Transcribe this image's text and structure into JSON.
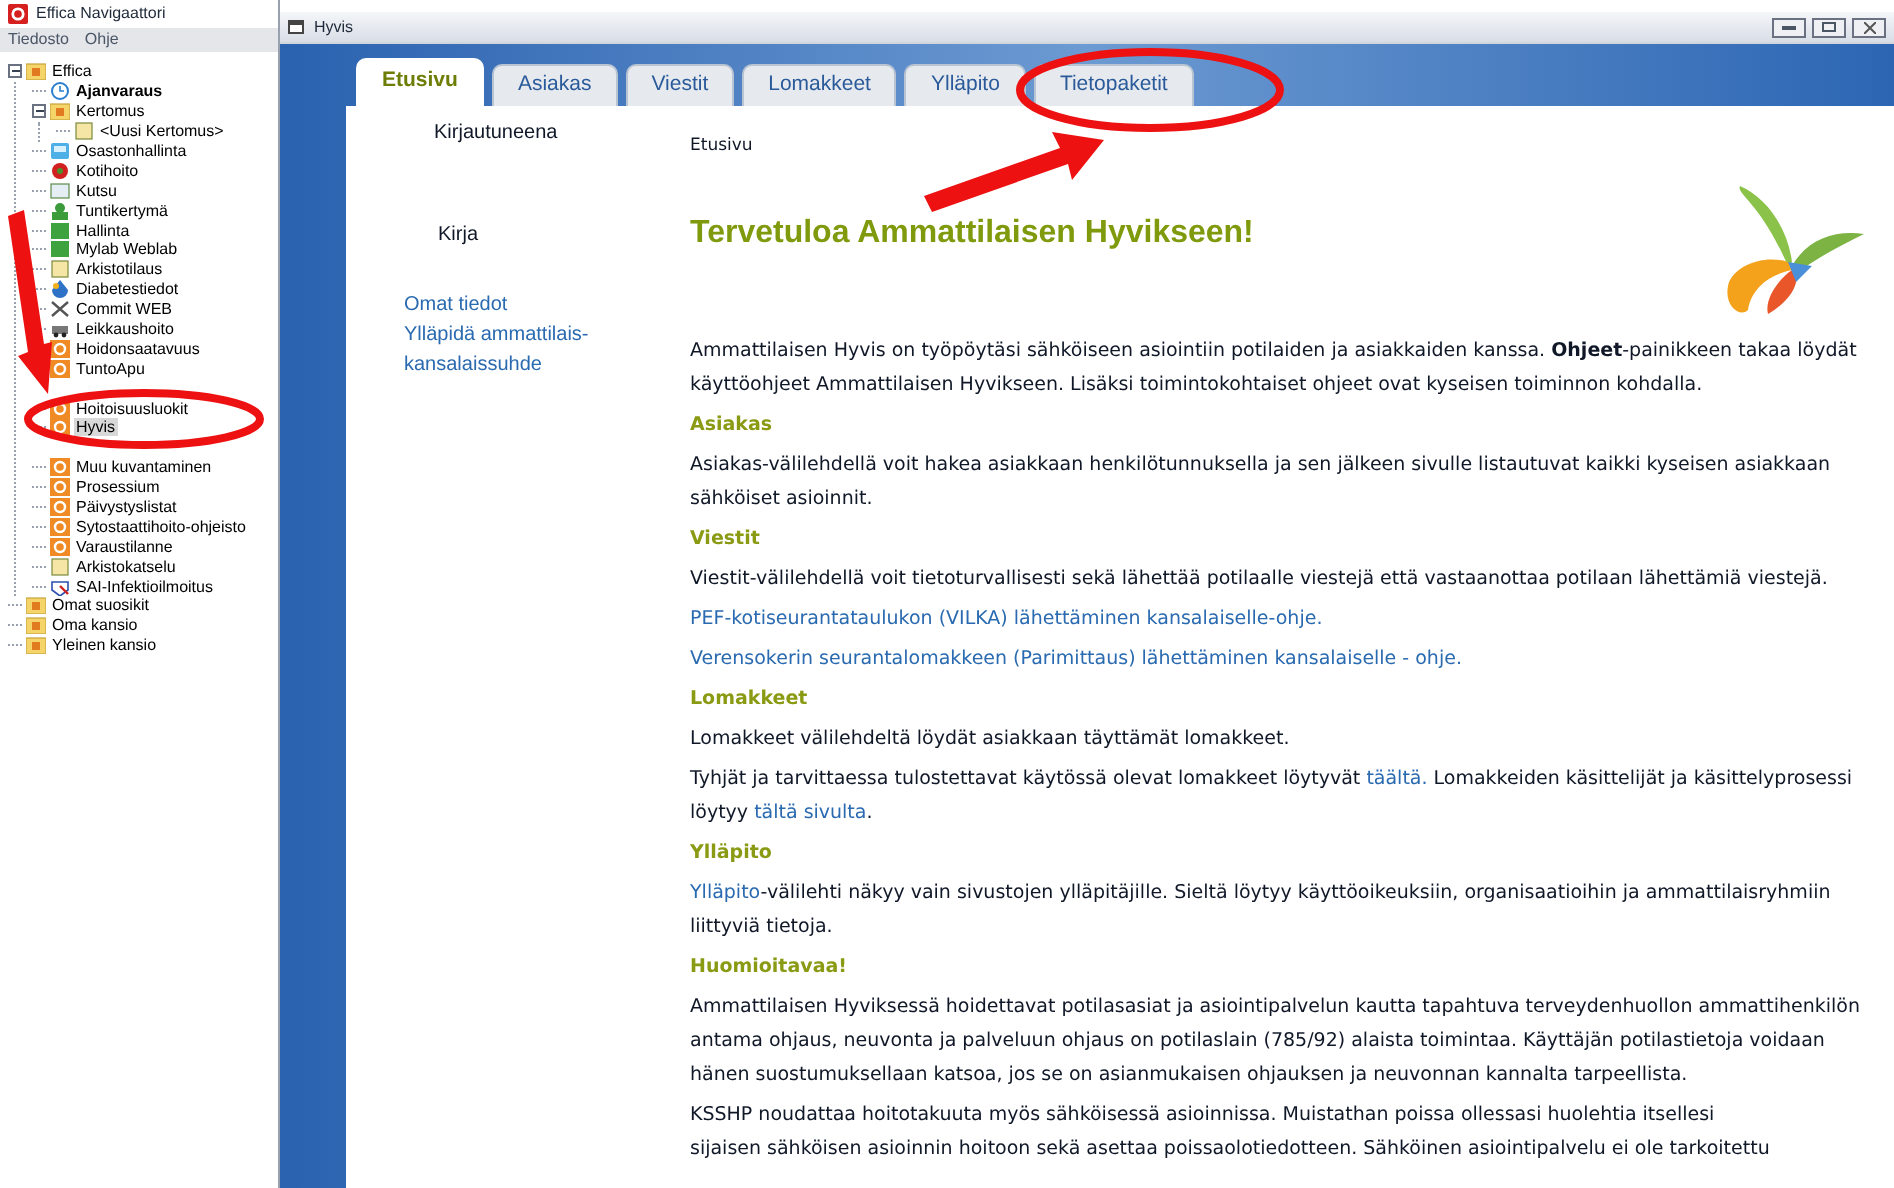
{
  "navigator": {
    "title": "Effica Navigaattori",
    "menu": [
      "Tiedosto",
      "Ohje"
    ],
    "tree": [
      {
        "label": "Effica",
        "expanded": true,
        "selected": false,
        "default": false,
        "children": [
          {
            "label": "Ajanvaraus",
            "selected": false,
            "default": true
          },
          {
            "label": "Kertomus",
            "expanded": true,
            "selected": false,
            "default": false,
            "children": [
              {
                "label": "<Uusi Kertomus>",
                "selected": false,
                "default": false
              }
            ]
          },
          {
            "label": "Osastonhallinta",
            "selected": false,
            "default": false
          },
          {
            "label": "Kotihoito",
            "selected": false,
            "default": false
          },
          {
            "label": "Kutsu",
            "selected": false,
            "default": false
          },
          {
            "label": "Tuntikertymä",
            "selected": false,
            "default": false
          },
          {
            "label": "Hallinta",
            "selected": false,
            "default": false
          },
          {
            "label": "Mylab Weblab",
            "selected": false,
            "default": false
          },
          {
            "label": "Arkistotilaus",
            "selected": false,
            "default": false
          },
          {
            "label": "Diabetestiedot",
            "selected": false,
            "default": false
          },
          {
            "label": "Commit WEB",
            "selected": false,
            "default": false
          },
          {
            "label": "Leikkaushoito",
            "selected": false,
            "default": false
          },
          {
            "label": "Hoidonsaatavuus",
            "selected": false,
            "default": false
          },
          {
            "label": "TuntoApu",
            "selected": false,
            "default": false
          },
          {
            "label": "Hoitoisuusluokit",
            "selected": false,
            "default": false
          },
          {
            "label": "Hyvis",
            "selected": true,
            "default": false
          },
          {
            "label": "Muu kuvantaminen",
            "selected": false,
            "default": false
          },
          {
            "label": "Prosessium",
            "selected": false,
            "default": false
          },
          {
            "label": "Päivystyslistat",
            "selected": false,
            "default": false
          },
          {
            "label": "Sytostaattihoito-ohjeisto",
            "selected": false,
            "default": false
          },
          {
            "label": "Varaustilanne",
            "selected": false,
            "default": false
          },
          {
            "label": "Arkistokatselu",
            "selected": false,
            "default": false
          },
          {
            "label": "SAI-Infektioilmoitus",
            "selected": false,
            "default": false
          }
        ]
      },
      {
        "label": "Omat suosikit",
        "selected": false,
        "default": false
      },
      {
        "label": "Oma kansio",
        "selected": false,
        "default": false
      },
      {
        "label": "Yleinen kansio",
        "selected": false,
        "default": false
      }
    ]
  },
  "window": {
    "title": "Hyvis"
  },
  "tabs": [
    {
      "label": "Etusivu",
      "selected": true
    },
    {
      "label": "Asiakas",
      "selected": false
    },
    {
      "label": "Viestit",
      "selected": false
    },
    {
      "label": "Lomakkeet",
      "selected": false
    },
    {
      "label": "Ylläpito",
      "selected": false
    },
    {
      "label": "Tietopaketit",
      "selected": false
    }
  ],
  "side": {
    "user_label": "Kirjautuneena",
    "user_name": "Kirja",
    "links": [
      "Omat tiedot",
      "Ylläpidä ammattilais-kansalaissuhde"
    ]
  },
  "breadcrumb": "Etusivu",
  "heading": "Tervetuloa Ammattilaisen Hyvikseen!",
  "content": [
    {
      "kind": "paragraph",
      "parts": [
        {
          "kind": "text",
          "text": "Ammattilaisen Hyvis on työpöytäsi sähköiseen asiointiin potilaiden ja asiakkaiden kanssa. **Ohjeet**-painikkeen takaa löydät käyttöohjeet Ammattilaisen Hyvikseen. Lisäksi toimintokohtaiset ohjeet ovat kyseisen toiminnon kohdalla."
        }
      ]
    },
    {
      "kind": "section",
      "text": "Asiakas"
    },
    {
      "kind": "paragraph",
      "parts": [
        {
          "kind": "text",
          "text": "Asiakas-välilehdellä voit hakea asiakkaan henkilötunnuksella ja sen jälkeen sivulle listautuvat kaikki kyseisen asiakkaan sähköiset asioinnit."
        }
      ]
    },
    {
      "kind": "section",
      "text": "Viestit"
    },
    {
      "kind": "paragraph",
      "parts": [
        {
          "kind": "text",
          "text": "Viestit-välilehdellä voit tietoturvallisesti sekä lähettää potilaalle viestejä että vastaanottaa potilaan lähettämiä viestejä."
        }
      ]
    },
    {
      "kind": "paragraph",
      "parts": [
        {
          "kind": "link",
          "text": "PEF-kotiseurantataulukon (VILKA) lähettäminen kansalaiselle-ohje."
        }
      ]
    },
    {
      "kind": "paragraph",
      "parts": [
        {
          "kind": "link",
          "text": "Verensokerin seurantalomakkeen (Parimittaus) lähettäminen kansalaiselle - ohje."
        }
      ]
    },
    {
      "kind": "section",
      "text": "Lomakkeet"
    },
    {
      "kind": "paragraph",
      "parts": [
        {
          "kind": "text",
          "text": "Lomakkeet välilehdeltä löydät asiakkaan täyttämät lomakkeet."
        }
      ]
    },
    {
      "kind": "paragraph",
      "parts": [
        {
          "kind": "text",
          "text": "Tyhjät ja tarvittaessa tulostettavat käytössä olevat lomakkeet löytyvät "
        },
        {
          "kind": "link",
          "text": "täältä."
        },
        {
          "kind": "text",
          "text": " Lomakkeiden käsittelijät ja käsittelyprosessi löytyy "
        },
        {
          "kind": "link",
          "text": "tältä sivulta"
        },
        {
          "kind": "text",
          "text": "."
        }
      ]
    },
    {
      "kind": "section",
      "text": "Ylläpito"
    },
    {
      "kind": "paragraph",
      "parts": [
        {
          "kind": "link",
          "text": "Ylläpito"
        },
        {
          "kind": "text",
          "text": "-välilehti näkyy vain sivustojen ylläpitäjille. Sieltä löytyy käyttöoikeuksiin, organisaatioihin ja ammattilaisryhmiin liittyviä tietoja."
        }
      ]
    },
    {
      "kind": "section",
      "text": "Huomioitavaa!"
    },
    {
      "kind": "paragraph",
      "parts": [
        {
          "kind": "text",
          "text": "Ammattilaisen Hyviksessä hoidettavat potilasasiat ja asiointipalvelun kautta tapahtuva terveydenhuollon ammattihenkilön antama ohjaus, neuvonta ja palveluun ohjaus on potilaslain (785/92) alaista toimintaa. Käyttäjän potilastietoja voidaan hänen suostumuksellaan katsoa, jos se on asianmukaisen ohjauksen ja neuvonnan kannalta tarpeellista."
        }
      ]
    },
    {
      "kind": "paragraph",
      "parts": [
        {
          "kind": "text",
          "text": "KSSHP noudattaa hoitotakuuta myös sähköisessä asioinnissa. Muistathan poissa ollessasi huolehtia itsellesi"
        },
        {
          "kind": "break"
        },
        {
          "kind": "text",
          "text": "sijaisen sähköisen asioinnin hoitoon sekä asettaa poissaolotiedotteen. Sähköinen asiointipalvelu ei ole tarkoitettu"
        }
      ]
    }
  ]
}
